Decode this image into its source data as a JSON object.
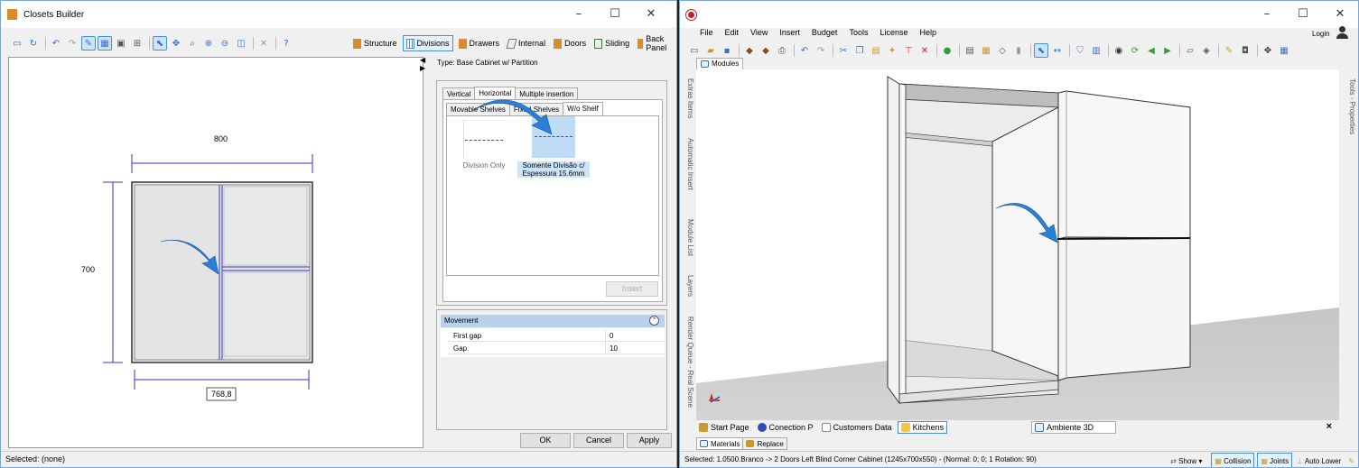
{
  "left_window": {
    "title": "Closets Builder",
    "controls": {
      "minimize": "–",
      "maximize": "☐",
      "close": "✕"
    },
    "mode_buttons": [
      {
        "label": "Structure",
        "color": "#d98c2b"
      },
      {
        "label": "Divisions",
        "color": "#4a90d9"
      },
      {
        "label": "Drawers",
        "color": "#d98c2b"
      },
      {
        "label": "Internal",
        "color": "#777777"
      },
      {
        "label": "Doors",
        "color": "#d98c2b"
      },
      {
        "label": "Sliding",
        "color": "#3a7a3a"
      },
      {
        "label": "Back Panel",
        "color": "#d98c2b"
      }
    ],
    "drawing": {
      "width_label": "800",
      "height_label": "700",
      "inner_width_label": "768,8"
    },
    "type_label": "Type: Base Cabinet w/ Partition",
    "outer_tabs": [
      "Vertical",
      "Horizontal",
      "Multiple insertion"
    ],
    "inner_tabs": [
      "Movable Shelves",
      "Fixed Shelves",
      "W/o Shelf"
    ],
    "options": [
      {
        "label": "Division Only"
      },
      {
        "label": "Somente Divisão c/ Espessura 15.6mm"
      }
    ],
    "insert_button": "Insert",
    "movement": {
      "header": "Movement",
      "rows": [
        {
          "name": "First gap",
          "value": "0"
        },
        {
          "name": "Gap",
          "value": "10"
        }
      ]
    },
    "buttons": {
      "ok": "OK",
      "cancel": "Cancel",
      "apply": "Apply"
    },
    "status": "Selected: (none)"
  },
  "right_window": {
    "controls": {
      "minimize": "–",
      "maximize": "☐",
      "close": "✕"
    },
    "menu": [
      "File",
      "Edit",
      "View",
      "Insert",
      "Budget",
      "Tools",
      "License",
      "Help"
    ],
    "login": "Login",
    "modules_tab": "Modules",
    "side_tabs": [
      "Extras Items",
      "Automatic Insert",
      "Module List",
      "Layers",
      "Render Queue - Real Scene"
    ],
    "right_side_tab": "Tools - Properties",
    "doc_tabs": [
      "Start Page",
      "Conection P",
      "Customers Data",
      "Kitchens",
      "Ambiente 3D"
    ],
    "doc_close": "×",
    "bottom_tabs": [
      "Materials",
      "Replace"
    ],
    "status": "Selected: 1.0500.Branco -> 2 Doors Left Blind Corner Cabinet (1245x700x550) - (Normal: 0; 0; 1 Rotation: 90)",
    "status_buttons": [
      "Show",
      "Collision",
      "Joints",
      "Auto Lower"
    ]
  },
  "colors": {
    "accent": "#4a90d9",
    "dimension": "#3333cc",
    "arrow": "#2b7fd4",
    "selection": "#cce4f7"
  }
}
